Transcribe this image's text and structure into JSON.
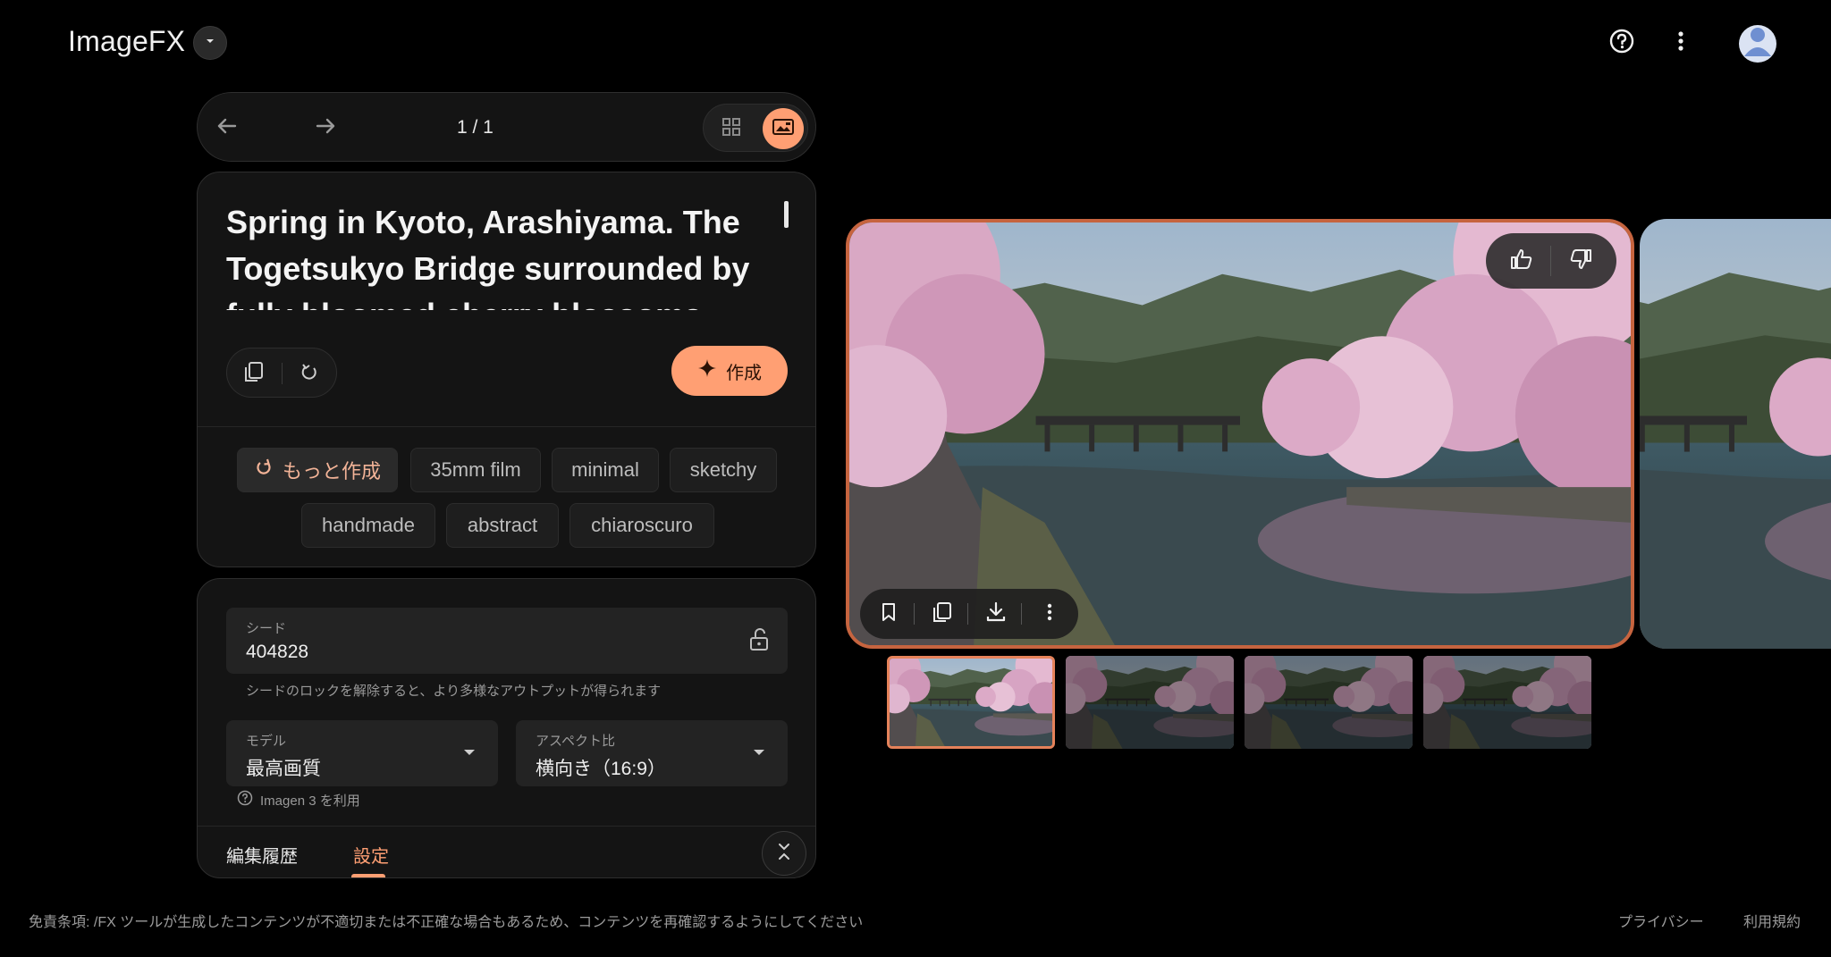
{
  "app": {
    "title": "ImageFX"
  },
  "pager": {
    "count": "1 / 1"
  },
  "prompt": {
    "text": "Spring in Kyoto, Arashiyama. The Togetsukyo Bridge surrounded by fully bloomed cherry blossoms. The"
  },
  "actions": {
    "create_label": "作成",
    "more_label": "もっと作成"
  },
  "chips": [
    "35mm film",
    "minimal",
    "sketchy",
    "handmade",
    "abstract",
    "chiaroscuro"
  ],
  "settings": {
    "seed_label": "シード",
    "seed_value": "404828",
    "seed_helper": "シードのロックを解除すると、より多様なアウトプットが得られます",
    "model_label": "モデル",
    "model_value": "最高画質",
    "aspect_label": "アスペクト比",
    "aspect_value": "横向き（16:9）",
    "imagen_note": "Imagen 3 を利用"
  },
  "tabs": {
    "history": "編集履歴",
    "settings": "設定"
  },
  "footer": {
    "disclaimer": "免責条項: /FX ツールが生成したコンテンツが不適切または不正確な場合もあるため、コンテンツを再確認するようにしてください",
    "privacy": "プライバシー",
    "terms": "利用規約"
  },
  "colors": {
    "accent": "#ff9f73",
    "selected_border": "#c6643f",
    "background": "#000000",
    "panel": "#141414"
  }
}
